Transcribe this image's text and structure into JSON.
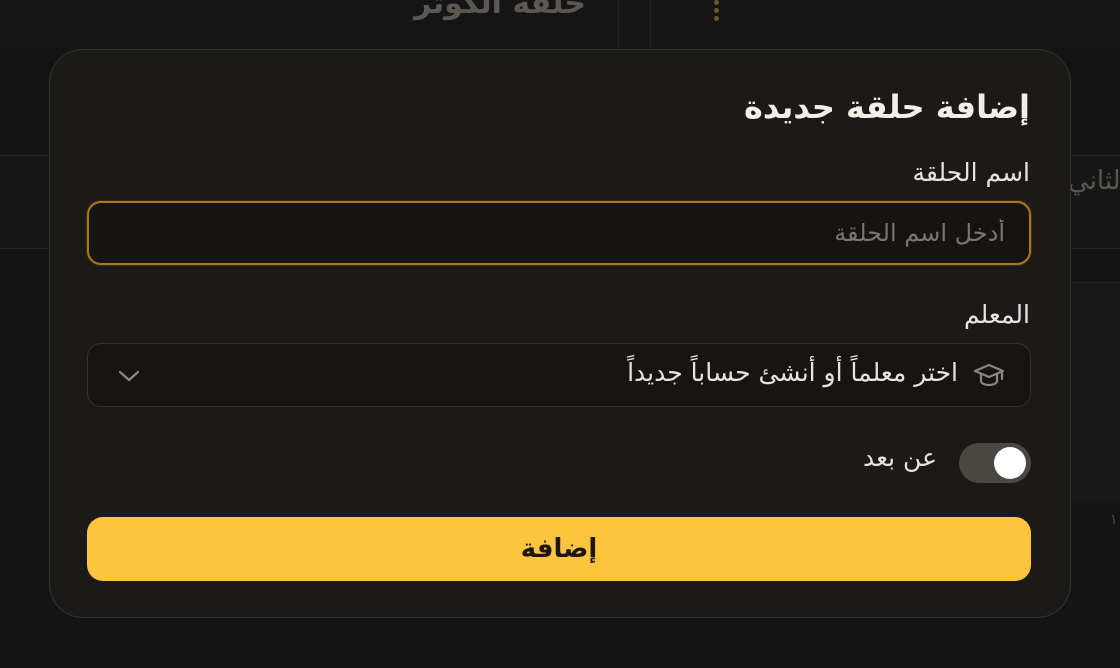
{
  "background": {
    "page_title": "حلقة الكوثر",
    "right_partial_text": "الثاني",
    "right_small_text": "١"
  },
  "modal": {
    "title": "إضافة حلقة جديدة",
    "name_field": {
      "label": "اسم الحلقة",
      "placeholder": "أدخل اسم الحلقة",
      "value": ""
    },
    "teacher_field": {
      "label": "المعلم",
      "selected_text": "اختر معلماً أو أنشئ حساباً جديداً",
      "icon": "graduation-cap-icon"
    },
    "remote_toggle": {
      "label": "عن بعد",
      "on": true
    },
    "submit_label": "إضافة"
  },
  "colors": {
    "accent": "#ffc43d",
    "focus_border": "#a37a1c",
    "modal_bg": "#1b1a18",
    "page_bg": "#141414"
  }
}
